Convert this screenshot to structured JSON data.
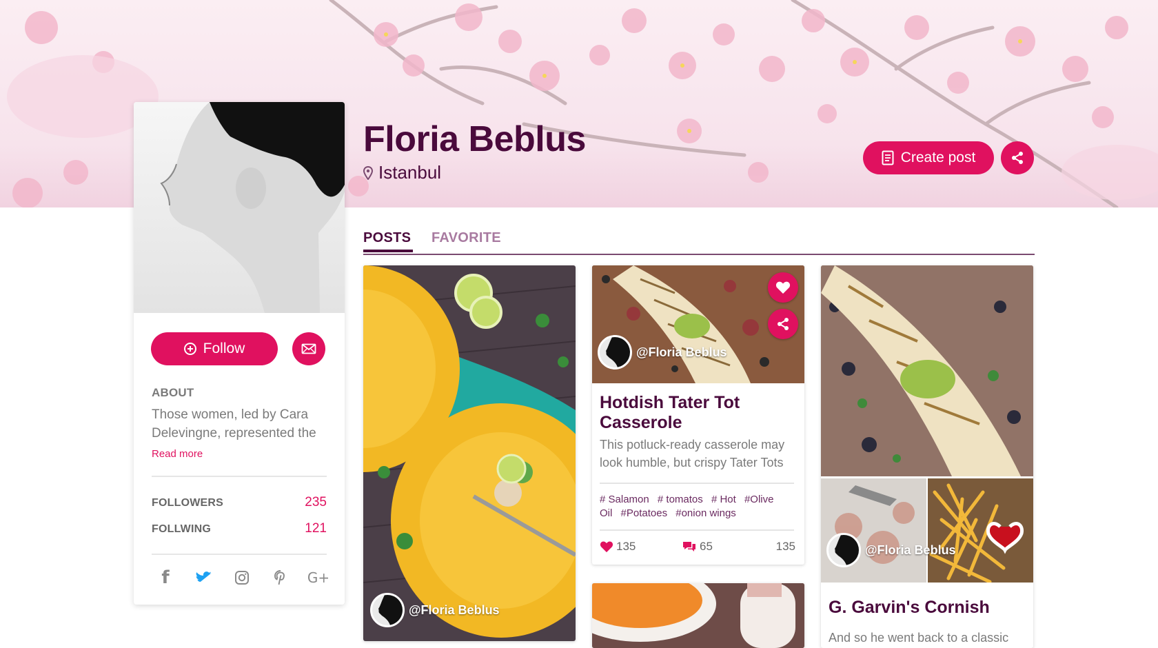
{
  "profile": {
    "name": "Floria Beblus",
    "location": "Istanbul",
    "follow_label": "Follow",
    "about_heading": "ABOUT",
    "about_text": "Those women, led by Cara Delevingne, represented the",
    "read_more": "Read more",
    "followers_label": "FOLLOWERS",
    "followers_count": "235",
    "following_label": "FOLLWING",
    "following_count": "121",
    "social": [
      "facebook-icon",
      "twitter-icon",
      "instagram-icon",
      "pinterest-icon",
      "google-plus-icon"
    ]
  },
  "header": {
    "create_post_label": "Create post"
  },
  "tabs": [
    {
      "label": "POSTS",
      "active": true
    },
    {
      "label": "FAVORITE",
      "active": false
    }
  ],
  "posts": [
    {
      "author": "@Floria Beblus"
    },
    {
      "author": "@Floria Beblus",
      "title": "Hotdish Tater Tot Casserole",
      "description": "This potluck-ready casserole may look humble, but crispy Tater Tots",
      "tags": [
        "# Salamon",
        "# tomatos",
        "# Hot",
        "#Olive Oil",
        "#Potatoes",
        "#onion wings"
      ],
      "likes": "135",
      "comments": "65",
      "views": "135"
    },
    {
      "author": "@Floria Beblus",
      "title": "G. Garvin's Cornish",
      "description": "And so he went back to a classic"
    }
  ],
  "colors": {
    "accent": "#e0115f",
    "heading": "#4a0a3c",
    "muted": "#7a7a7a"
  }
}
